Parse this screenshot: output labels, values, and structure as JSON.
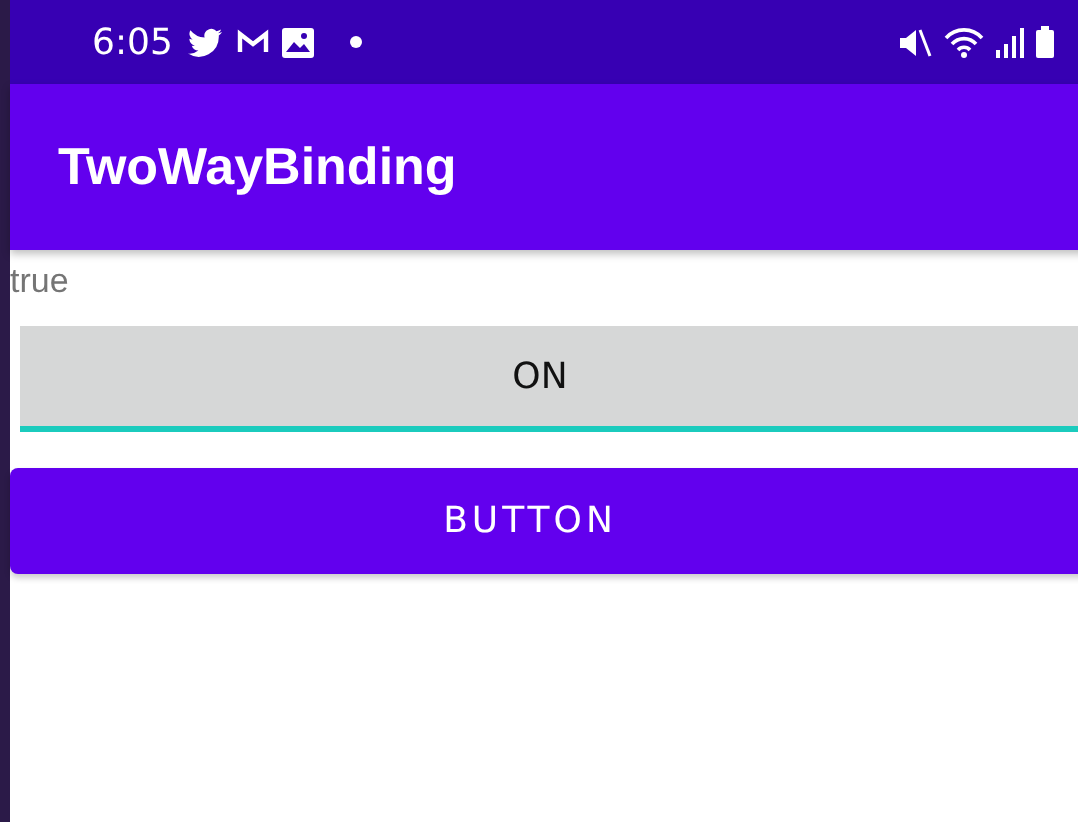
{
  "status_bar": {
    "time": "6:05"
  },
  "app_bar": {
    "title": "TwoWayBinding"
  },
  "bound_text": "true",
  "toggle": {
    "label": "ON",
    "checked": true
  },
  "button": {
    "label": "BUTTON"
  }
}
